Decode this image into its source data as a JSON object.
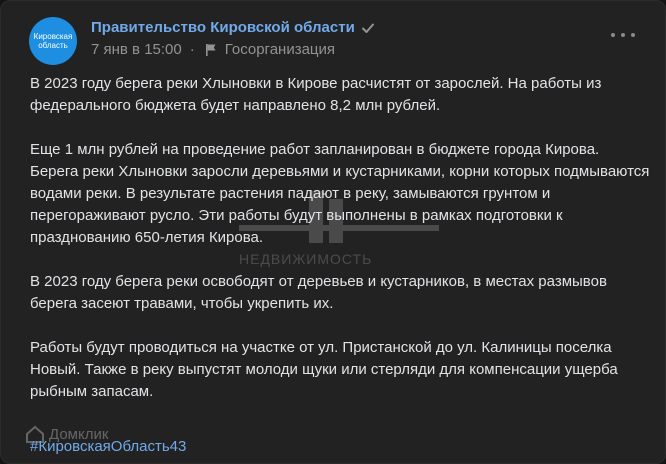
{
  "post": {
    "author": "Правительство Кировской области",
    "avatar_text": [
      "Кировская",
      "область"
    ],
    "date": "7 янв в 15:00",
    "separator": "·",
    "category": "Госорганизация",
    "paragraphs": [
      "В 2023 году берега реки Хлыновки в Кирове расчистят от зарослей. На работы из федерального бюджета будет направлено 8,2 млн рублей.",
      "Еще 1 млн рублей на проведение работ запланирован в бюджете города Кирова. Берега реки Хлыновки заросли деревьями и кустарниками, корни которых подмываются водами реки. В результате растения падают в реку, замываются грунтом и перегораживают русло. Эти работы будут выполнены в рамках подготовки к празднованию 650-летия Кирова.",
      "В 2023 году берега реки освободят от деревьев и кустарников, в местах размывов берега засеют травами, чтобы укрепить их.",
      "Работы будут проводиться на участке от ул. Пристанской до ул. Калиницы поселка Новый. Также в реку выпустят молоди щуки или стерляди для компенсации ущерба рыбным запасам."
    ],
    "hashtag": "#КировскаяОбласть43"
  },
  "watermarks": {
    "center": "НЕДВИЖИМОСТЬ",
    "bottom": "Домклик"
  },
  "colors": {
    "background": "#222222",
    "link": "#71aaeb",
    "text": "#e1e3e6",
    "muted": "#939393",
    "avatar": "#1d8ee0"
  },
  "icons": [
    "verified-icon",
    "flag-icon",
    "more-icon"
  ]
}
